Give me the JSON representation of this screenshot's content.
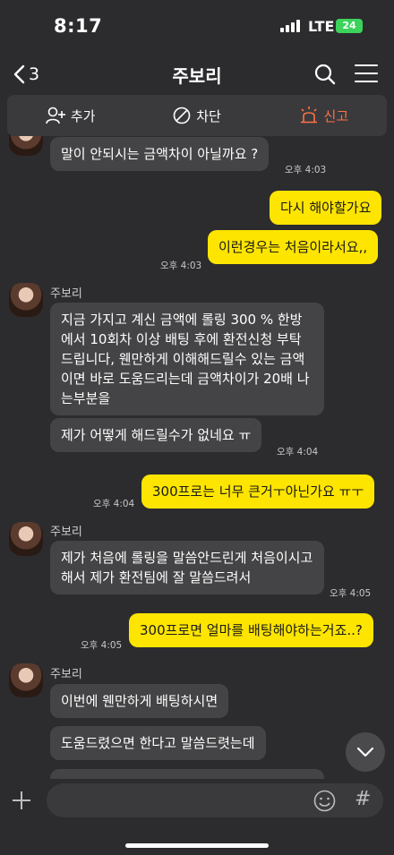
{
  "status": {
    "time": "8:17",
    "network": "LTE",
    "battery": "24"
  },
  "header": {
    "back_count": "3",
    "title": "주보리"
  },
  "actions": {
    "add": "추가",
    "block": "차단",
    "report": "신고"
  },
  "messages": {
    "m1": "말이 안되시는 금액차이 아닐까요 ?",
    "m1_time": "오후 4:03",
    "m2": "다시 해야할가요",
    "m3": "이런경우는 처음이라서요,,",
    "m3_time": "오후 4:03",
    "sender": "주보리",
    "m4": "지금 가지고 계신 금액에 롤링 300 % 한방에서 10회차 이상 배팅 후에 환전신청 부탁드립니다, 웬만하게 이해해드릴수 있는 금액이면 바로 도움드리는데 금액차이가 20배 나는부분을",
    "m5": "제가 어떻게 해드릴수가 없네요 ㅠ",
    "m5_time": "오후 4:04",
    "m6": "300프로는 너무 큰거ㅜ아닌가요 ㅠㅜ",
    "m6_time": "오후 4:04",
    "m7": "제가 처음에 롤링을 말씀안드린게 처음이시고 해서 제가 환전팀에 잘 말씀드려서",
    "m7_time": "오후 4:05",
    "m8": "300프로면 얼마를 배팅해야하는거죠..?",
    "m8_time": "오후 4:05",
    "m9": "이번에 웬만하게 배팅하시면",
    "m10": "도움드렸으면 한다고 말씀드렷는데"
  },
  "input": {
    "placeholder": ""
  },
  "colors": {
    "accent": "#fee500",
    "report": "#ff7043",
    "bg": "#2c2c2e"
  },
  "icons": [
    "chevron-left-icon",
    "search-icon",
    "menu-icon",
    "add-friend-icon",
    "block-icon",
    "siren-icon",
    "chevron-down-icon",
    "plus-icon",
    "emoji-icon",
    "hash-icon"
  ]
}
